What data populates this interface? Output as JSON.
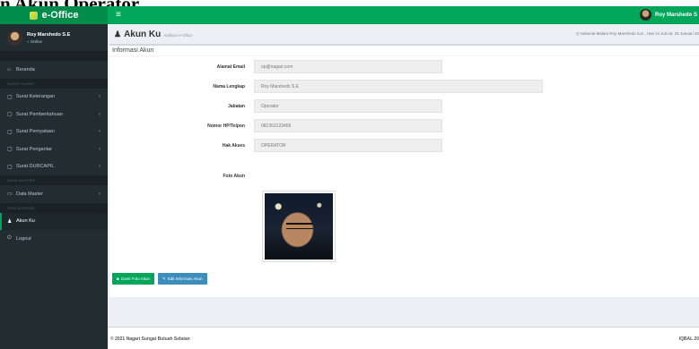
{
  "page_heading": "n Akun Operator",
  "topbar": {
    "brand": "e-Office",
    "menu_toggle": "≡",
    "user_name": "Roy Marshedo S"
  },
  "sidebar": {
    "user": {
      "name": "Roy Marshedo S.E",
      "status": "Online"
    },
    "sections": [
      {
        "header": "",
        "items": [
          {
            "label": "Beranda",
            "icon": "home-icon"
          }
        ]
      },
      {
        "header": "SURAT-SURAT",
        "items": [
          {
            "label": "Surat Keterangan",
            "icon": "document-icon",
            "chevron": true
          },
          {
            "label": "Surat Pemberitahuan",
            "icon": "document-icon",
            "chevron": true
          },
          {
            "label": "Surat Pernyataan",
            "icon": "document-icon",
            "chevron": true
          },
          {
            "label": "Surat Pengantar",
            "icon": "document-icon",
            "chevron": true
          },
          {
            "label": "Surat DURCAPIL",
            "icon": "document-icon",
            "chevron": true
          }
        ]
      },
      {
        "header": "DATA MASTER",
        "items": [
          {
            "label": "Data Master",
            "icon": "folder-icon",
            "chevron": true
          }
        ]
      },
      {
        "header": "PENGATURAN",
        "items": [
          {
            "label": "Akun Ku",
            "icon": "user-icon",
            "active": true
          },
          {
            "label": "Logout",
            "icon": "power-icon"
          }
        ]
      }
    ]
  },
  "content_header": {
    "title": "Akun Ku",
    "subtitle": "Aplikasi e-Office",
    "greeting": "Selamat Malam Roy Marshedo S.E., Hari ini Jum'at, 25 Januari 20"
  },
  "box": {
    "title": "Informasi Akun",
    "fields": [
      {
        "label": "Alamat Email",
        "value": "op@nagari.com"
      },
      {
        "label": "Nama Lengkap",
        "value": "Roy Marshedo S.E"
      },
      {
        "label": "Jabatan",
        "value": "Operator"
      },
      {
        "label": "Nomor HP/Telpon",
        "value": "081363123456"
      },
      {
        "label": "Hak Akses",
        "value": "OPERATOR"
      }
    ],
    "photo_label": "Foto Akun",
    "buttons": {
      "change_photo": "Ganti Foto Akun",
      "edit_info": "Edit Informasi Akun"
    }
  },
  "footer": {
    "left": "© 2021 Nagari Sungai Buluah Selatan",
    "right": "IQBAL 20"
  },
  "colors": {
    "accent": "#00a65a",
    "sidebar": "#222d32",
    "button_blue": "#3c8dbc"
  }
}
